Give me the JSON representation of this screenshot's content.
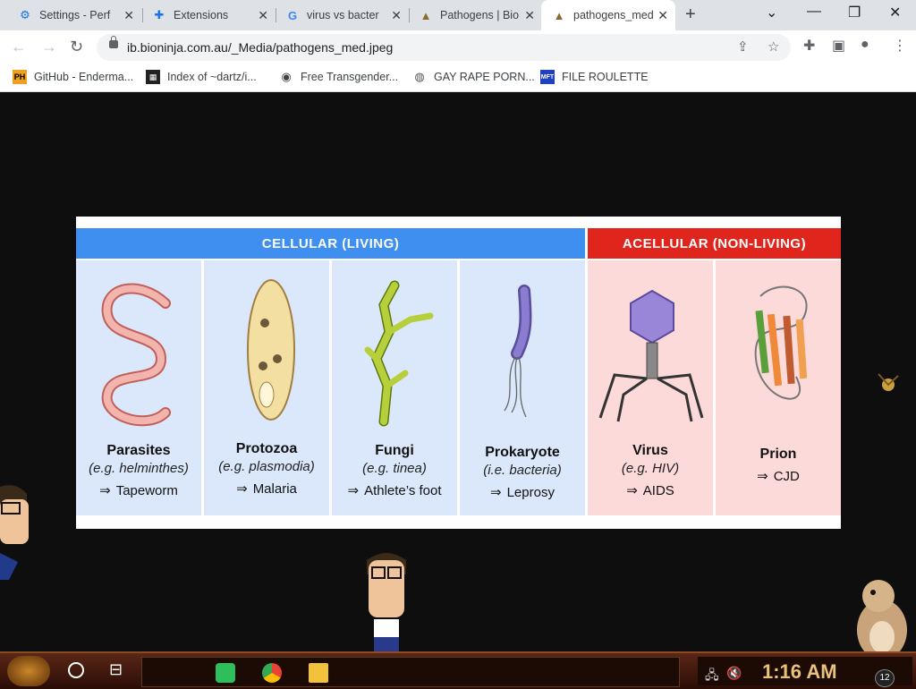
{
  "browser": {
    "tabs": [
      {
        "title": "Settings - Perf",
        "icon": "gear-icon",
        "active": false
      },
      {
        "title": "Extensions",
        "icon": "puzzle-icon",
        "active": false
      },
      {
        "title": "virus vs bacter",
        "icon": "google-icon",
        "active": false
      },
      {
        "title": "Pathogens | Bio",
        "icon": "bioninja-icon",
        "active": false
      },
      {
        "title": "pathogens_med",
        "icon": "bioninja-icon",
        "active": true
      }
    ],
    "url": "ib.bioninja.com.au/_Media/pathogens_med.jpeg",
    "bookmarks": [
      {
        "label": "GitHub - Enderma...",
        "icon": "PH"
      },
      {
        "label": "Index of ~dartz/i...",
        "icon": "folder"
      },
      {
        "label": "Free Transgender...",
        "icon": "globe"
      },
      {
        "label": "GAY RAPE PORN...",
        "icon": "globe"
      },
      {
        "label": "FILE ROULETTE",
        "icon": "MFT"
      }
    ]
  },
  "image": {
    "header_left": "CELLULAR  (LIVING)",
    "header_right": "ACELLULAR  (NON-LIVING)",
    "colors": {
      "cellular": "#3f8ff0",
      "acellular": "#e0251d",
      "panel_blue": "#dbe8fb",
      "panel_pink": "#fcdada"
    },
    "panels": [
      {
        "name": "Parasites",
        "example": "(e.g. helminthes)",
        "disease": "Tapeworm"
      },
      {
        "name": "Protozoa",
        "example": "(e.g. plasmodia)",
        "disease": "Malaria"
      },
      {
        "name": "Fungi",
        "example": "(e.g. tinea)",
        "disease": "Athlete’s foot"
      },
      {
        "name": "Prokaryote",
        "example": "(i.e. bacteria)",
        "disease": "Leprosy"
      },
      {
        "name": "Virus",
        "example": "(e.g. HIV)",
        "disease": "AIDS"
      },
      {
        "name": "Prion",
        "example": "",
        "disease": "CJD"
      }
    ],
    "arrow": "⇒"
  },
  "taskbar": {
    "clock": "1:16 AM",
    "notifications": "12"
  }
}
